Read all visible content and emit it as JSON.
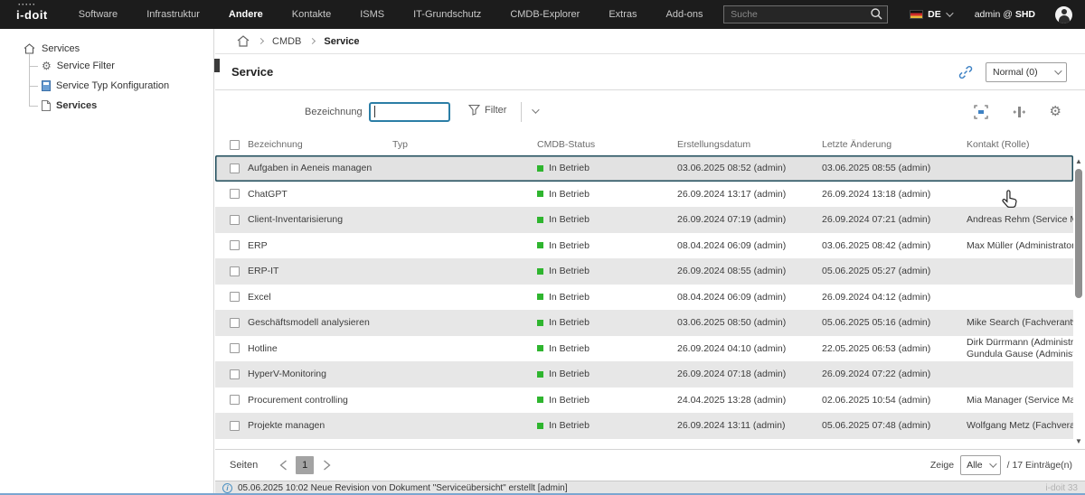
{
  "topbar": {
    "logo": "i-doit",
    "menu": [
      "Software",
      "Infrastruktur",
      "Andere",
      "Kontakte",
      "ISMS",
      "IT-Grundschutz",
      "CMDB-Explorer",
      "Extras",
      "Add-ons"
    ],
    "search_placeholder": "Suche",
    "lang": "DE",
    "user_prefix": "admin @",
    "user_org": "SHD"
  },
  "sidebar": {
    "root_label": "Services",
    "items": [
      {
        "label": "Service Filter",
        "icon": "gear-icon"
      },
      {
        "label": "Service Typ Konfiguration",
        "icon": "document-blue-icon"
      },
      {
        "label": "Services",
        "icon": "document-icon",
        "active": true
      }
    ]
  },
  "breadcrumb": {
    "items": [
      "CMDB",
      "Service"
    ]
  },
  "page": {
    "title": "Service",
    "view_dropdown_value": "Normal (0)"
  },
  "filter": {
    "label": "Bezeichnung",
    "value": "",
    "button_label": "Filter"
  },
  "table": {
    "headers": [
      "Bezeichnung",
      "Typ",
      "CMDB-Status",
      "Erstellungsdatum",
      "Letzte Änderung",
      "Kontakt (Rolle)"
    ],
    "rows": [
      {
        "name": "Aufgaben in Aeneis managen",
        "typ": "",
        "status": "In Betrieb",
        "created": "03.06.2025 08:52 (admin)",
        "modified": "03.06.2025 08:55 (admin)",
        "contact": [],
        "selected": true
      },
      {
        "name": "ChatGPT",
        "typ": "",
        "status": "In Betrieb",
        "created": "26.09.2024 13:17 (admin)",
        "modified": "26.09.2024 13:18 (admin)",
        "contact": []
      },
      {
        "name": "Client-Inventarisierung",
        "typ": "",
        "status": "In Betrieb",
        "created": "26.09.2024 07:19 (admin)",
        "modified": "26.09.2024 07:21 (admin)",
        "contact": [
          "Andreas Rehm (Service Manager)"
        ]
      },
      {
        "name": "ERP",
        "typ": "",
        "status": "In Betrieb",
        "created": "08.04.2024 06:09 (admin)",
        "modified": "03.06.2025 08:42 (admin)",
        "contact": [
          "Max Müller (Administrator)"
        ]
      },
      {
        "name": "ERP-IT",
        "typ": "",
        "status": "In Betrieb",
        "created": "26.09.2024 08:55 (admin)",
        "modified": "05.06.2025 05:27 (admin)",
        "contact": []
      },
      {
        "name": "Excel",
        "typ": "",
        "status": "In Betrieb",
        "created": "08.04.2024 06:09 (admin)",
        "modified": "26.09.2024 04:12 (admin)",
        "contact": []
      },
      {
        "name": "Geschäftsmodell analysieren",
        "typ": "",
        "status": "In Betrieb",
        "created": "03.06.2025 08:50 (admin)",
        "modified": "05.06.2025 05:16 (admin)",
        "contact": [
          "Mike Search (Fachverantwortliche"
        ]
      },
      {
        "name": "Hotline",
        "typ": "",
        "status": "In Betrieb",
        "created": "26.09.2024 04:10 (admin)",
        "modified": "22.05.2025 06:53 (admin)",
        "contact": [
          "Dirk Dürrmann (Administrator)",
          "Gundula Gause (Administrator)"
        ]
      },
      {
        "name": "HyperV-Monitoring",
        "typ": "",
        "status": "In Betrieb",
        "created": "26.09.2024 07:18 (admin)",
        "modified": "26.09.2024 07:22 (admin)",
        "contact": []
      },
      {
        "name": "Procurement controlling",
        "typ": "",
        "status": "In Betrieb",
        "created": "24.04.2025 13:28 (admin)",
        "modified": "02.06.2025 10:54 (admin)",
        "contact": [
          "Mia Manager (Service Manager)"
        ]
      },
      {
        "name": "Projekte managen",
        "typ": "",
        "status": "In Betrieb",
        "created": "26.09.2024 13:11 (admin)",
        "modified": "05.06.2025 07:48 (admin)",
        "contact": [
          "Wolfgang Metz (Fachverantwortli"
        ]
      }
    ]
  },
  "pagination": {
    "label": "Seiten",
    "current_page": "1",
    "zeige_label": "Zeige",
    "zeige_value": "Alle",
    "entries_total": "/ 17 Einträge(n)"
  },
  "statusbar": {
    "message": "05.06.2025 10:02 Neue Revision von Dokument \"Serviceübersicht\" erstellt [admin]",
    "version": "i-doit 33"
  },
  "icons": {
    "gear": "⚙",
    "scroll_up": "▲",
    "scroll_down": "▼",
    "info": "i",
    "drag_handle": "⣿"
  },
  "colors": {
    "accent_blue": "#2b7ea6",
    "status_green": "#2fb52f",
    "selected_border": "#1d4b5a",
    "topbar_bg": "#1c1c1c"
  }
}
